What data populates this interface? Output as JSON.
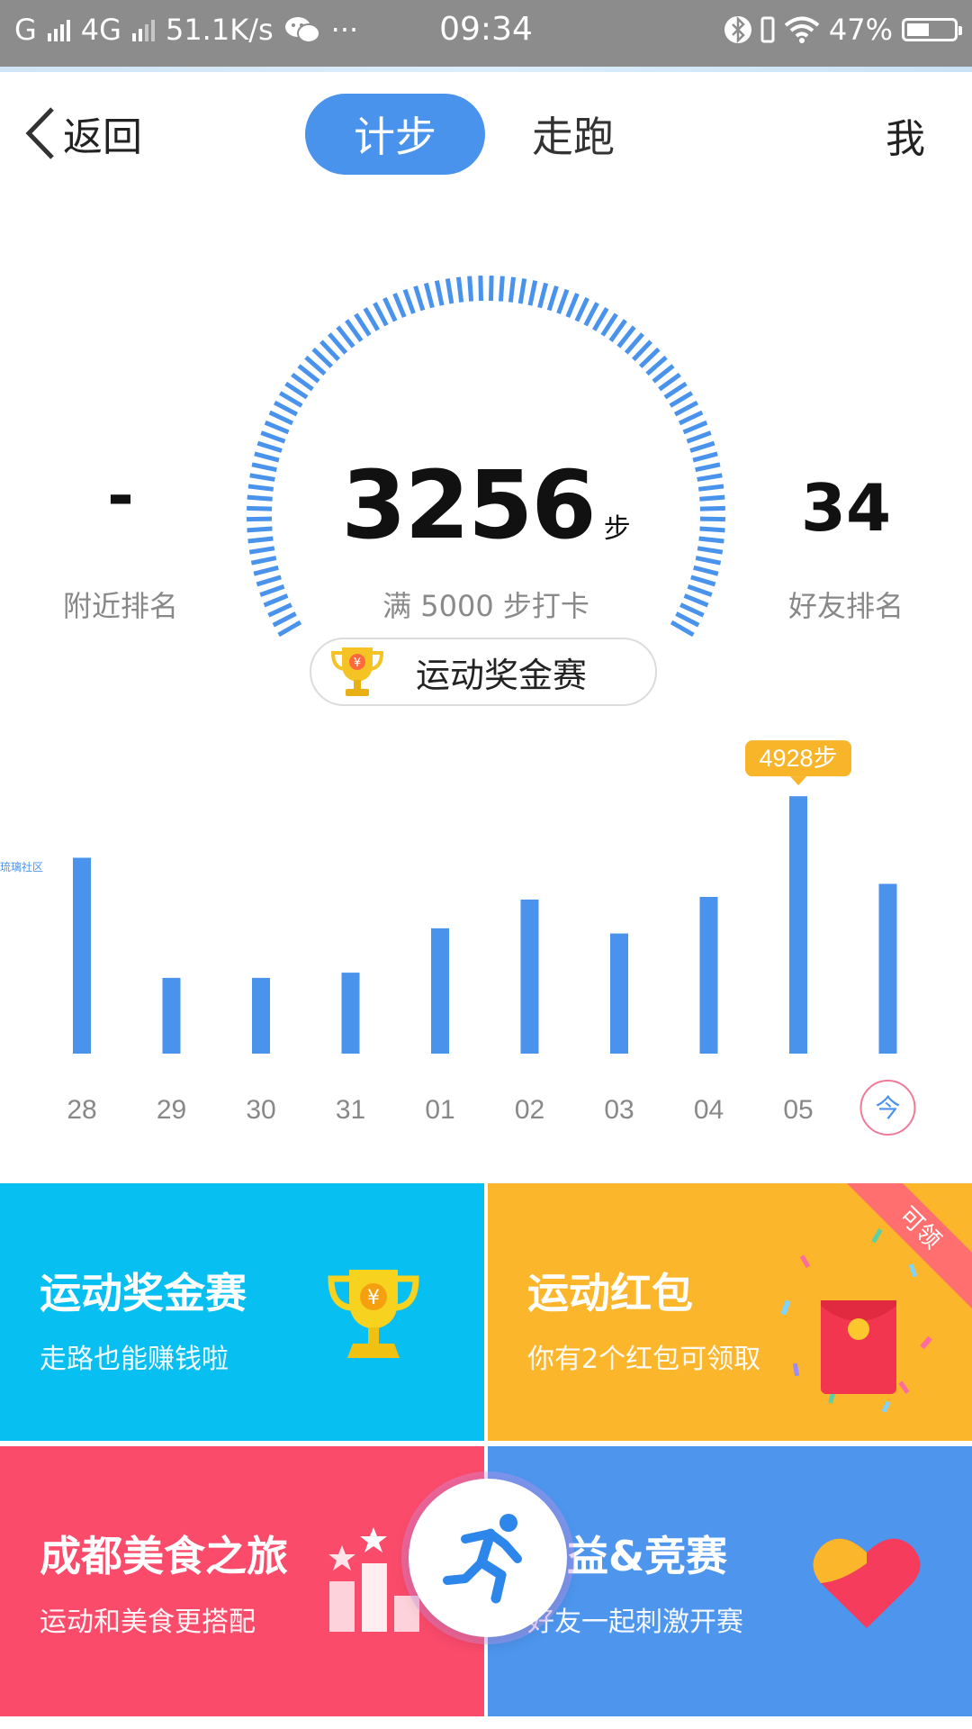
{
  "status_bar": {
    "carrier": "G",
    "network": "4G",
    "speed": "51.1K/s",
    "more": "···",
    "time": "09:34",
    "battery": "47%",
    "battery_level": 0.47
  },
  "header": {
    "back_label": "返回",
    "tabs": [
      {
        "label": "计步",
        "active": true
      },
      {
        "label": "走跑",
        "active": false
      }
    ],
    "me_label": "我"
  },
  "summary": {
    "nearby_rank_value": "-",
    "nearby_rank_label": "附近排名",
    "steps": "3256",
    "steps_unit": "步",
    "goal_text": "满 5000 步打卡",
    "friend_rank_value": "34",
    "friend_rank_label": "好友排名",
    "progress": 0.6512,
    "contest_button": "运动奖金赛"
  },
  "watermark": "琉璃社区",
  "chart_data": {
    "type": "bar",
    "categories": [
      "28",
      "29",
      "30",
      "31",
      "01",
      "02",
      "03",
      "04",
      "05",
      "今"
    ],
    "values": [
      3750,
      1450,
      1450,
      1550,
      2400,
      2950,
      2300,
      3000,
      4928,
      3250
    ],
    "highlight_index": 8,
    "highlight_label": "4928步",
    "color": "#4a93ec",
    "highlight_color": "#f8b52a",
    "today_circle_color": "#f07a98"
  },
  "cards": [
    {
      "title": "运动奖金赛",
      "subtitle": "走路也能赚钱啦",
      "color": "#08bff1",
      "icon": "trophy-icon"
    },
    {
      "title": "运动红包",
      "subtitle": "你有2个红包可领取",
      "color": "#fbb62c",
      "icon": "red-envelope-icon",
      "badge": "可领"
    },
    {
      "title": "成都美食之旅",
      "subtitle": "运动和美食更搭配",
      "color": "#fa4b6b",
      "icon": "podium-icon"
    },
    {
      "title": "益&竞赛",
      "subtitle": "好友一起刺激开赛",
      "color": "#4d95ed",
      "icon": "heart-icon"
    }
  ],
  "fab": {
    "icon": "runner-icon"
  }
}
